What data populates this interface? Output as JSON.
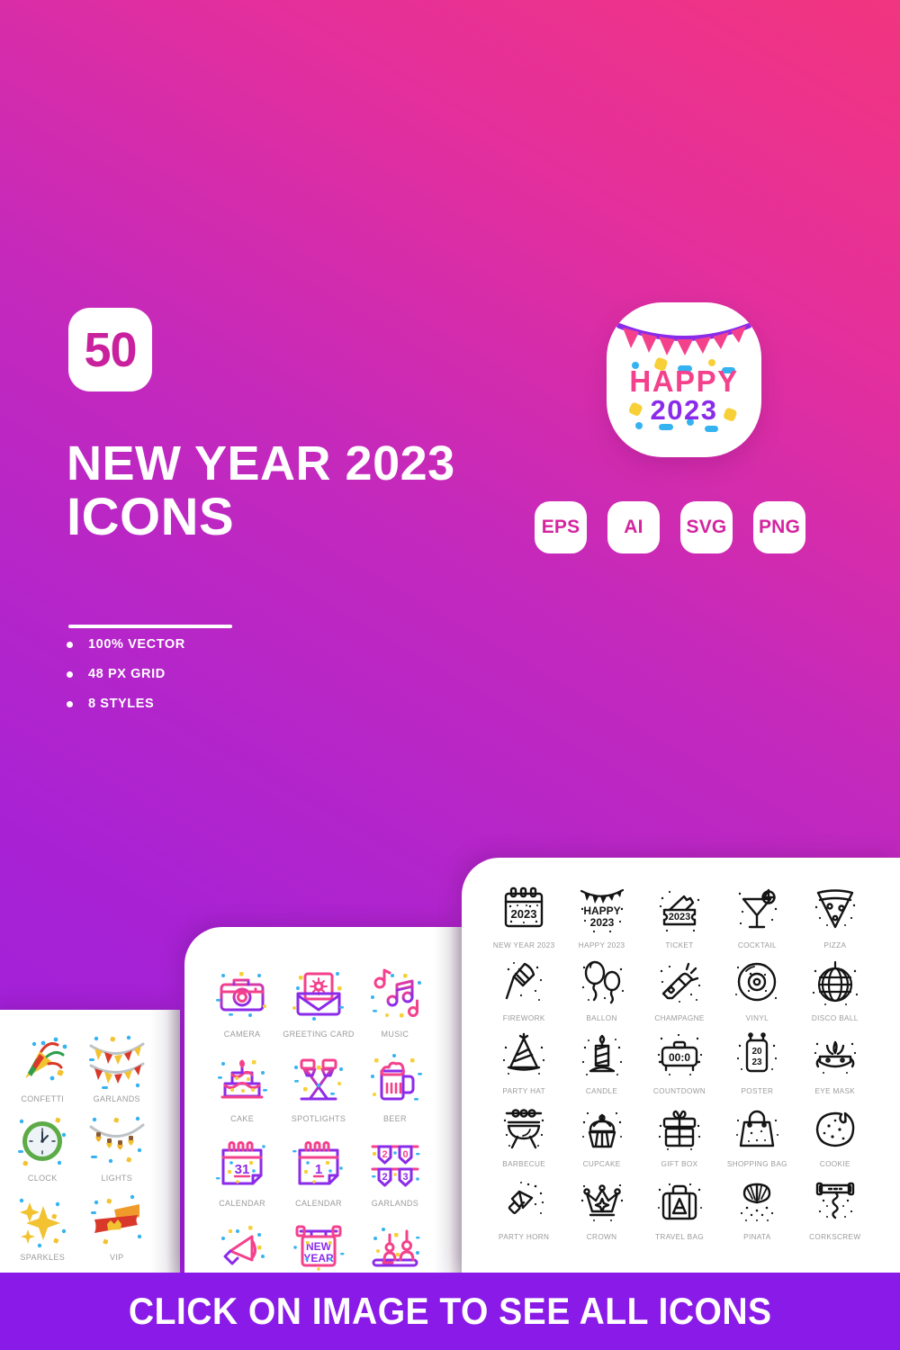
{
  "hero": {
    "count": "50",
    "title_line1": "NEW YEAR 2023",
    "title_line2": "ICONS",
    "features": [
      {
        "label": "100% VECTOR"
      },
      {
        "label": "48 PX GRID"
      },
      {
        "label": "8 STYLES"
      }
    ]
  },
  "logo": {
    "word_top": "HAPPY",
    "word_bottom": "2023",
    "colors": {
      "pink": "#f4418c",
      "purple": "#8b2bea",
      "yellow": "#f7d038",
      "blue": "#35b3f0",
      "tile": "#ffffff"
    }
  },
  "formats": [
    {
      "label": "EPS"
    },
    {
      "label": "AI"
    },
    {
      "label": "SVG"
    },
    {
      "label": "PNG"
    }
  ],
  "colors": {
    "gradient_start": "#9a1fe0",
    "gradient_end": "#f2357f",
    "badge_text": "#c9219e",
    "banner": "#8a1ae8",
    "label_gray": "#9b9b9b",
    "line_black": "#1a1a1a"
  },
  "panel_right": {
    "style": "line",
    "columns": 5,
    "icons": [
      {
        "name": "new-year-2023",
        "label": "NEW YEAR 2023",
        "text": "2023"
      },
      {
        "name": "happy-2023",
        "label": "HAPPY 2023",
        "text": "HAPPY 2023"
      },
      {
        "name": "ticket",
        "label": "TICKET",
        "text": "2023"
      },
      {
        "name": "cocktail",
        "label": "COCKTAIL",
        "text": ""
      },
      {
        "name": "pizza",
        "label": "PIZZA",
        "text": ""
      },
      {
        "name": "firework",
        "label": "FIREWORK",
        "text": ""
      },
      {
        "name": "ballon",
        "label": "BALLON",
        "text": ""
      },
      {
        "name": "champagne",
        "label": "CHAMPAGNE",
        "text": ""
      },
      {
        "name": "vinyl",
        "label": "VINYL",
        "text": ""
      },
      {
        "name": "disco-ball",
        "label": "DISCO BALL",
        "text": ""
      },
      {
        "name": "party-hat",
        "label": "PARTY HAT",
        "text": ""
      },
      {
        "name": "candle",
        "label": "CANDLE",
        "text": ""
      },
      {
        "name": "countdown",
        "label": "COUNTDOWN",
        "text": "00:0"
      },
      {
        "name": "poster",
        "label": "POSTER",
        "text": "20 23"
      },
      {
        "name": "eye-mask",
        "label": "EYE MASK",
        "text": ""
      },
      {
        "name": "barbecue",
        "label": "BARBECUE",
        "text": ""
      },
      {
        "name": "cupcake",
        "label": "CUPCAKE",
        "text": ""
      },
      {
        "name": "gift-box",
        "label": "GIFT BOX",
        "text": ""
      },
      {
        "name": "shopping-bag",
        "label": "SHOPPING BAG",
        "text": ""
      },
      {
        "name": "cookie",
        "label": "COOKIE",
        "text": ""
      },
      {
        "name": "party-horn",
        "label": "PARTY HORN",
        "text": ""
      },
      {
        "name": "crown",
        "label": "CROWN",
        "text": ""
      },
      {
        "name": "travel-bag",
        "label": "TRAVEL BAG",
        "text": ""
      },
      {
        "name": "pinata",
        "label": "PINATA",
        "text": ""
      },
      {
        "name": "corkscrew",
        "label": "CORKSCREW",
        "text": ""
      }
    ]
  },
  "panel_mid": {
    "style": "duotone-gradient",
    "columns": 3,
    "icons": [
      {
        "name": "camera",
        "label": "CAMERA",
        "text": ""
      },
      {
        "name": "greeting-card",
        "label": "GREETING CARD",
        "text": ""
      },
      {
        "name": "music",
        "label": "MUSIC",
        "text": ""
      },
      {
        "name": "cake",
        "label": "CAKE",
        "text": ""
      },
      {
        "name": "spotlights",
        "label": "SPOTLIGHTS",
        "text": ""
      },
      {
        "name": "beer",
        "label": "BEER",
        "text": ""
      },
      {
        "name": "calendar-31",
        "label": "CALENDAR",
        "text": "31"
      },
      {
        "name": "calendar-1",
        "label": "CALENDAR",
        "text": "1"
      },
      {
        "name": "garlands",
        "label": "GARLANDS",
        "text": "2023"
      },
      {
        "name": "megaphone",
        "label": "MEGAPHONE",
        "text": ""
      },
      {
        "name": "happy-new-year",
        "label": "HAPPY NEW YEAR",
        "text": "NEW YEAR"
      },
      {
        "name": "canapes",
        "label": "CANAPES",
        "text": ""
      }
    ]
  },
  "panel_left": {
    "style": "flat",
    "columns": 2,
    "icons": [
      {
        "name": "confetti",
        "label": "CONFETTI",
        "text": ""
      },
      {
        "name": "garlands",
        "label": "GARLANDS",
        "text": ""
      },
      {
        "name": "clock",
        "label": "CLOCK",
        "text": ""
      },
      {
        "name": "lights",
        "label": "LIGHTS",
        "text": ""
      },
      {
        "name": "sparkles",
        "label": "SPARKLES",
        "text": ""
      },
      {
        "name": "vip",
        "label": "VIP",
        "text": ""
      }
    ]
  },
  "cta": {
    "label": "CLICK ON IMAGE TO SEE ALL ICONS"
  }
}
